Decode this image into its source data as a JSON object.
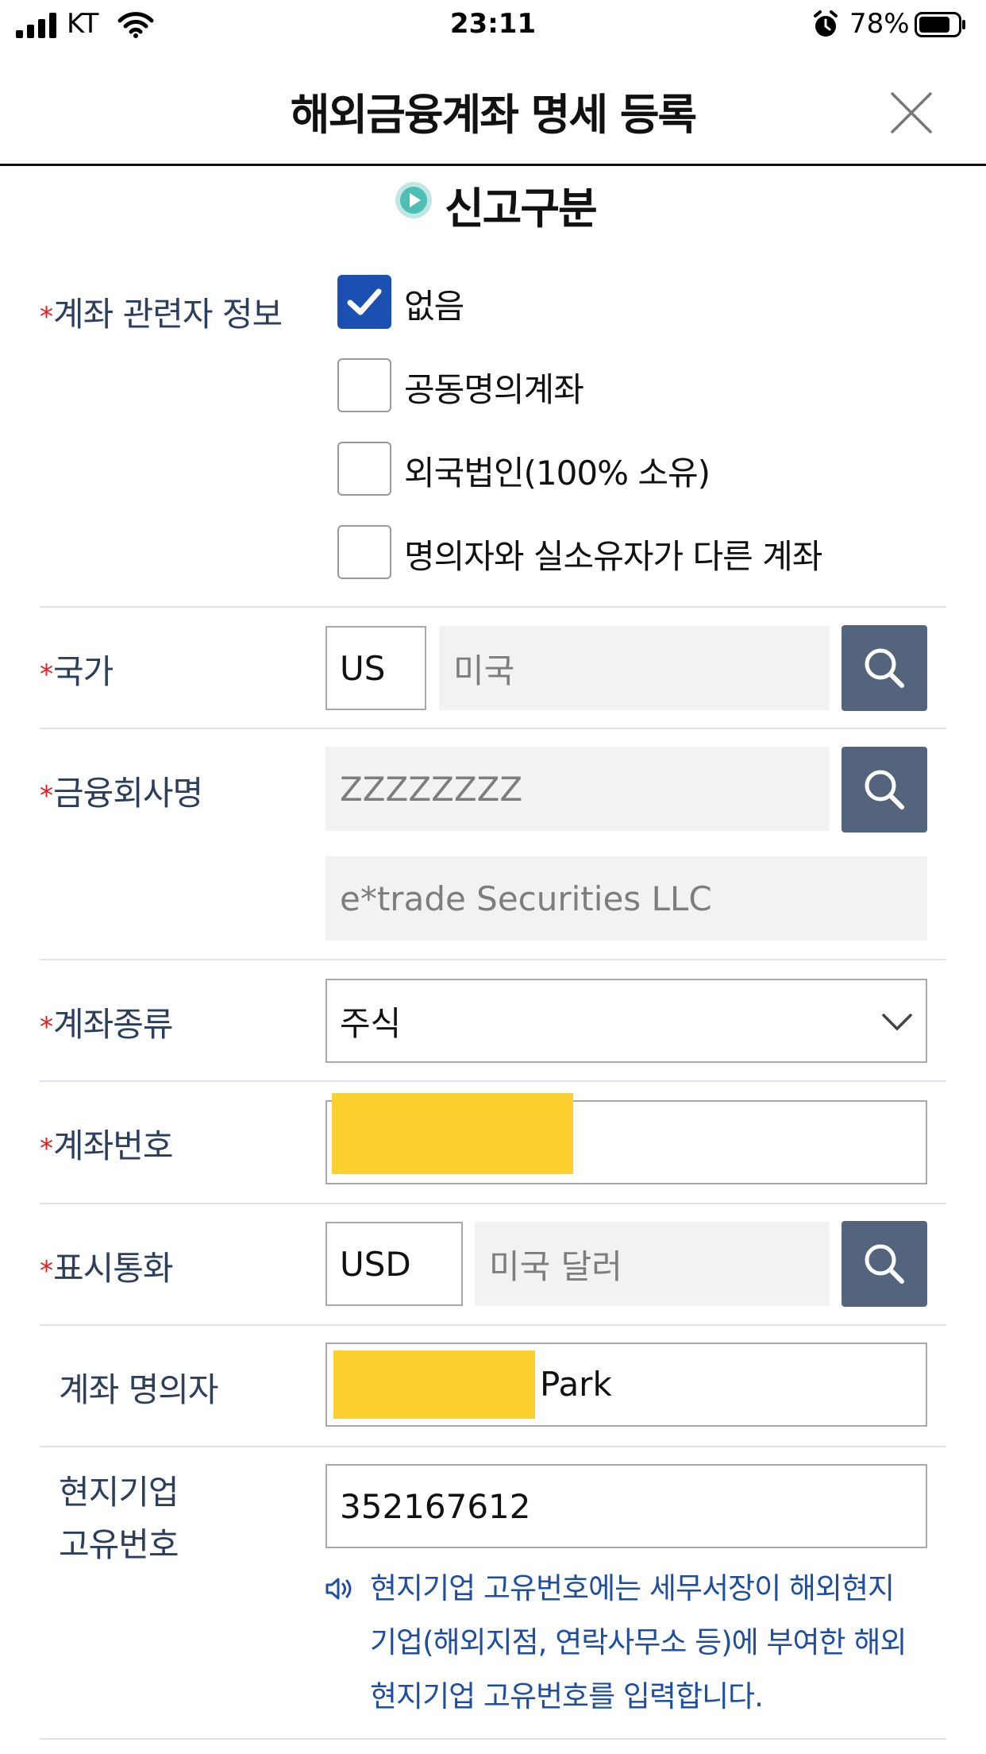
{
  "status_bar": {
    "carrier": "KT",
    "time": "23:11",
    "battery": "78%"
  },
  "header": {
    "title": "해외금융계좌 명세 등록"
  },
  "section": {
    "title": "신고구분"
  },
  "form": {
    "required_mark": "*",
    "relation": {
      "label": "계좌 관련자 정보",
      "options": [
        {
          "label": "없음",
          "checked": true
        },
        {
          "label": "공동명의계좌",
          "checked": false
        },
        {
          "label": "외국법인(100% 소유)",
          "checked": false
        },
        {
          "label": "명의자와 실소유자가 다른 계좌",
          "checked": false
        }
      ]
    },
    "country": {
      "label": "국가",
      "code": "US",
      "name": "미국"
    },
    "institution": {
      "label": "금융회사명",
      "code": "ZZZZZZZZ",
      "name": "e*trade Securities LLC"
    },
    "account_type": {
      "label": "계좌종류",
      "value": "주식"
    },
    "account_number": {
      "label": "계좌번호"
    },
    "currency": {
      "label": "표시통화",
      "code": "USD",
      "name": "미국 달러"
    },
    "holder": {
      "label": "계좌 명의자",
      "value": "Park"
    },
    "local_id": {
      "label_line1": "현지기업",
      "label_line2": "고유번호",
      "value": "352167612"
    },
    "note": {
      "line1": "현지기업 고유번호에는 세무서장이 해외현지",
      "line2": "기업(해외지점, 연락사무소 등)에 부여한 해외",
      "line3": "현지기업 고유번호를 입력합니다."
    }
  },
  "colors": {
    "primary": "#1c4fb2",
    "label": "#2b3e5c",
    "required": "#e02020",
    "search_button": "#55647d",
    "redaction": "#fcd02e",
    "note": "#1f4e9e",
    "accent": "#4ebfb5"
  }
}
